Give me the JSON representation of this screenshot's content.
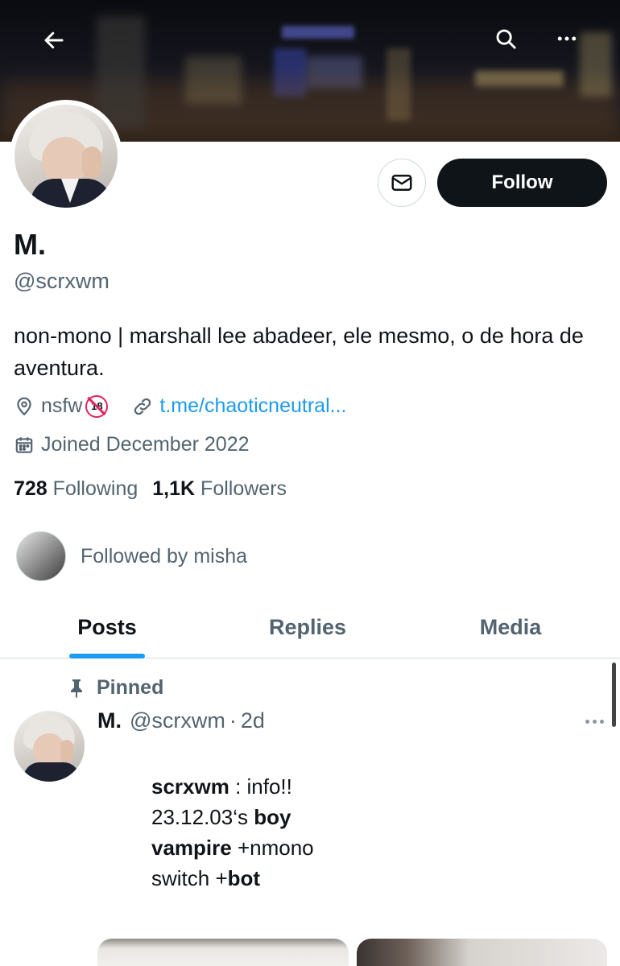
{
  "profile": {
    "display_name": "M.",
    "handle": "@scrxwm",
    "bio": "non-mono | marshall lee abadeer, ele mesmo, o de hora de aventura.",
    "location": "nsfw",
    "location_badge": "18",
    "link": "t.me/chaoticneutral...",
    "joined": "Joined December 2022",
    "following_count": "728",
    "following_label": "Following",
    "followers_count": "1,1K",
    "followers_label": "Followers",
    "followed_by": "Followed by misha"
  },
  "actions": {
    "follow_label": "Follow"
  },
  "tabs": [
    {
      "label": "Posts",
      "active": true
    },
    {
      "label": "Replies",
      "active": false
    },
    {
      "label": "Media",
      "active": false
    }
  ],
  "pinned_post": {
    "pinned_label": "Pinned",
    "author": "M.",
    "handle": "@scrxwm",
    "separator": "·",
    "time": "2d",
    "lines": [
      {
        "bold": "scrxwm",
        "rest": " : info!!"
      },
      {
        "pre": "23.12.03‘s ",
        "bold": "boy"
      },
      {
        "bold": "vampire",
        "rest": " +nmono"
      },
      {
        "pre": "switch +",
        "bold": "bot"
      }
    ]
  },
  "icons": {
    "back": "arrow-left-icon",
    "search": "search-icon",
    "more": "more-horizontal-icon",
    "message": "envelope-icon",
    "location": "location-pin-icon",
    "link": "link-icon",
    "calendar": "calendar-icon",
    "pin": "pin-icon"
  },
  "colors": {
    "accent": "#1d9bf0",
    "text_primary": "#0f1419",
    "text_secondary": "#536471",
    "button_dark": "#0f1419"
  }
}
